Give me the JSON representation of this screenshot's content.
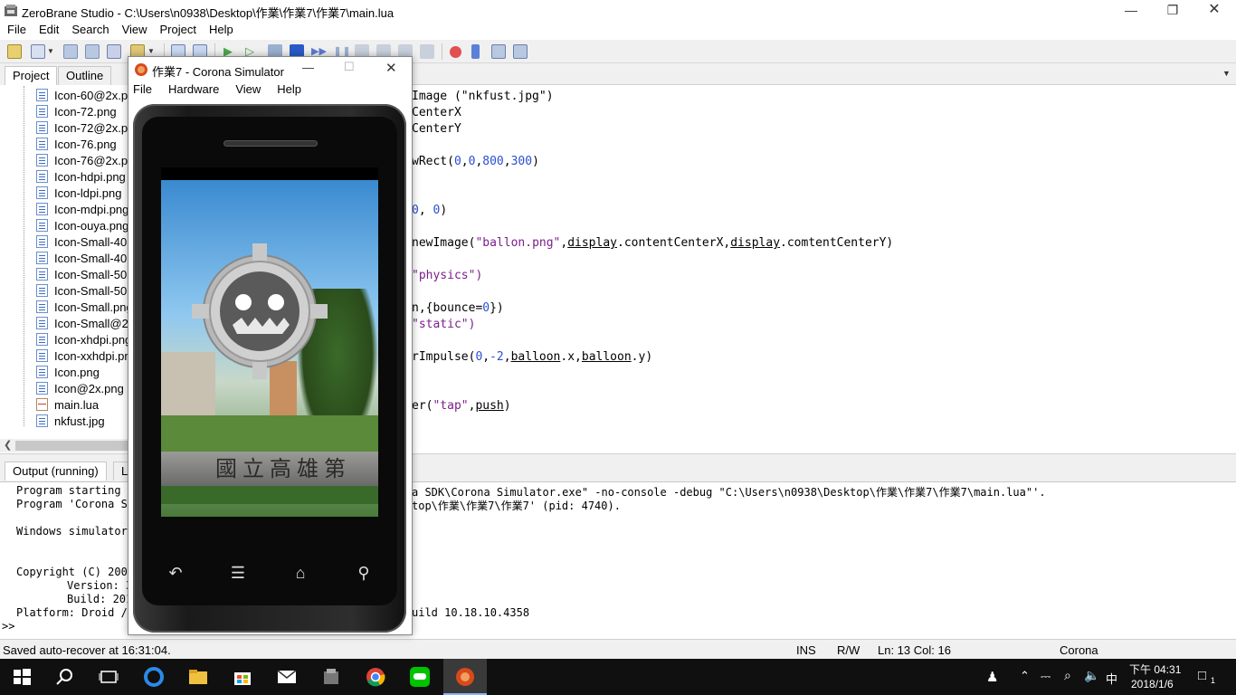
{
  "window": {
    "title": "ZeroBrane Studio - C:\\Users\\n0938\\Desktop\\作業\\作業7\\作業7\\main.lua"
  },
  "menu": [
    "File",
    "Edit",
    "Search",
    "View",
    "Project",
    "Help"
  ],
  "left_tabs": [
    "Project",
    "Outline"
  ],
  "tree": [
    "Icon-60@2x.png",
    "Icon-72.png",
    "Icon-72@2x.png",
    "Icon-76.png",
    "Icon-76@2x.png",
    "Icon-hdpi.png",
    "Icon-ldpi.png",
    "Icon-mdpi.png",
    "Icon-ouya.png",
    "Icon-Small-40.png",
    "Icon-Small-40@2x.png",
    "Icon-Small-50.png",
    "Icon-Small-50@2x.png",
    "Icon-Small.png",
    "Icon-Small@2x.png",
    "Icon-xhdpi.png",
    "Icon-xxhdpi.png",
    "Icon.png",
    "Icon@2x.png",
    "main.lua",
    "nkfust.jpg"
  ],
  "code": {
    "l1": "Image (\"nkfust.jpg\")",
    "l2": "CenterX",
    "l3": "CenterY",
    "l4a": "wRect(",
    "l4b": "0",
    "l4c": ",",
    "l4d": "0",
    "l4e": ",",
    "l4f": "800",
    "l4g": ",",
    "l4h": "300",
    "l4i": ")",
    "l5a": "0",
    "l5b": ", ",
    "l5c": "0",
    "l5d": ")",
    "l6a": "newImage(",
    "l6b": "\"ballon.png\"",
    "l6c": ",",
    "l6d": "display",
    "l6e": ".contentCenterX,",
    "l6f": "display",
    "l6g": ".comtentCenterY)",
    "l7": "\"physics\")",
    "l8a": "n,{bounce=",
    "l8b": "0",
    "l8c": "})",
    "l9": "\"static\")",
    "l10a": "rImpulse(",
    "l10b": "0",
    "l10c": ",",
    "l10d": "-2",
    "l10e": ",",
    "l10f": "balloon",
    "l10g": ".x,",
    "l10h": "balloon",
    "l10i": ".y)",
    "l11a": "er(",
    "l11b": "\"tap\"",
    "l11c": ",",
    "l11d": "push",
    "l11e": ")"
  },
  "output_tabs": [
    "Output (running)",
    "Lo"
  ],
  "output": {
    "o1a": "Program starting a",
    "o1b": "a SDK\\Corona Simulator.exe\" -no-console -debug \"C:\\Users\\n0938\\Desktop\\作業\\作業7\\作業7\\main.lua\"'.",
    "o2a": "Program 'Corona Si",
    "o2b": "top\\作業\\作業7\\作業7' (pid: 4740).",
    "o3": "Windows simulator",
    "o4": "Copyright (C) 2009",
    "o5": "Version: 3",
    "o6": "Build: 201",
    "o7a": "Platform: Droid /",
    "o7b": "uild 10.18.10.4358",
    "prompt": ">>"
  },
  "status": {
    "message": "Saved auto-recover at 16:31:04.",
    "mode": "INS",
    "rw": "R/W",
    "pos": "Ln: 13 Col: 16",
    "interpreter": "Corona"
  },
  "simulator": {
    "title": "作業7 - Corona Simulator",
    "menu": [
      "File",
      "Hardware",
      "View",
      "Help"
    ],
    "signage": "國立高雄第"
  },
  "taskbar": {
    "time": "下午 04:31",
    "date": "2018/1/6",
    "ime": "中",
    "notifications": "1"
  }
}
